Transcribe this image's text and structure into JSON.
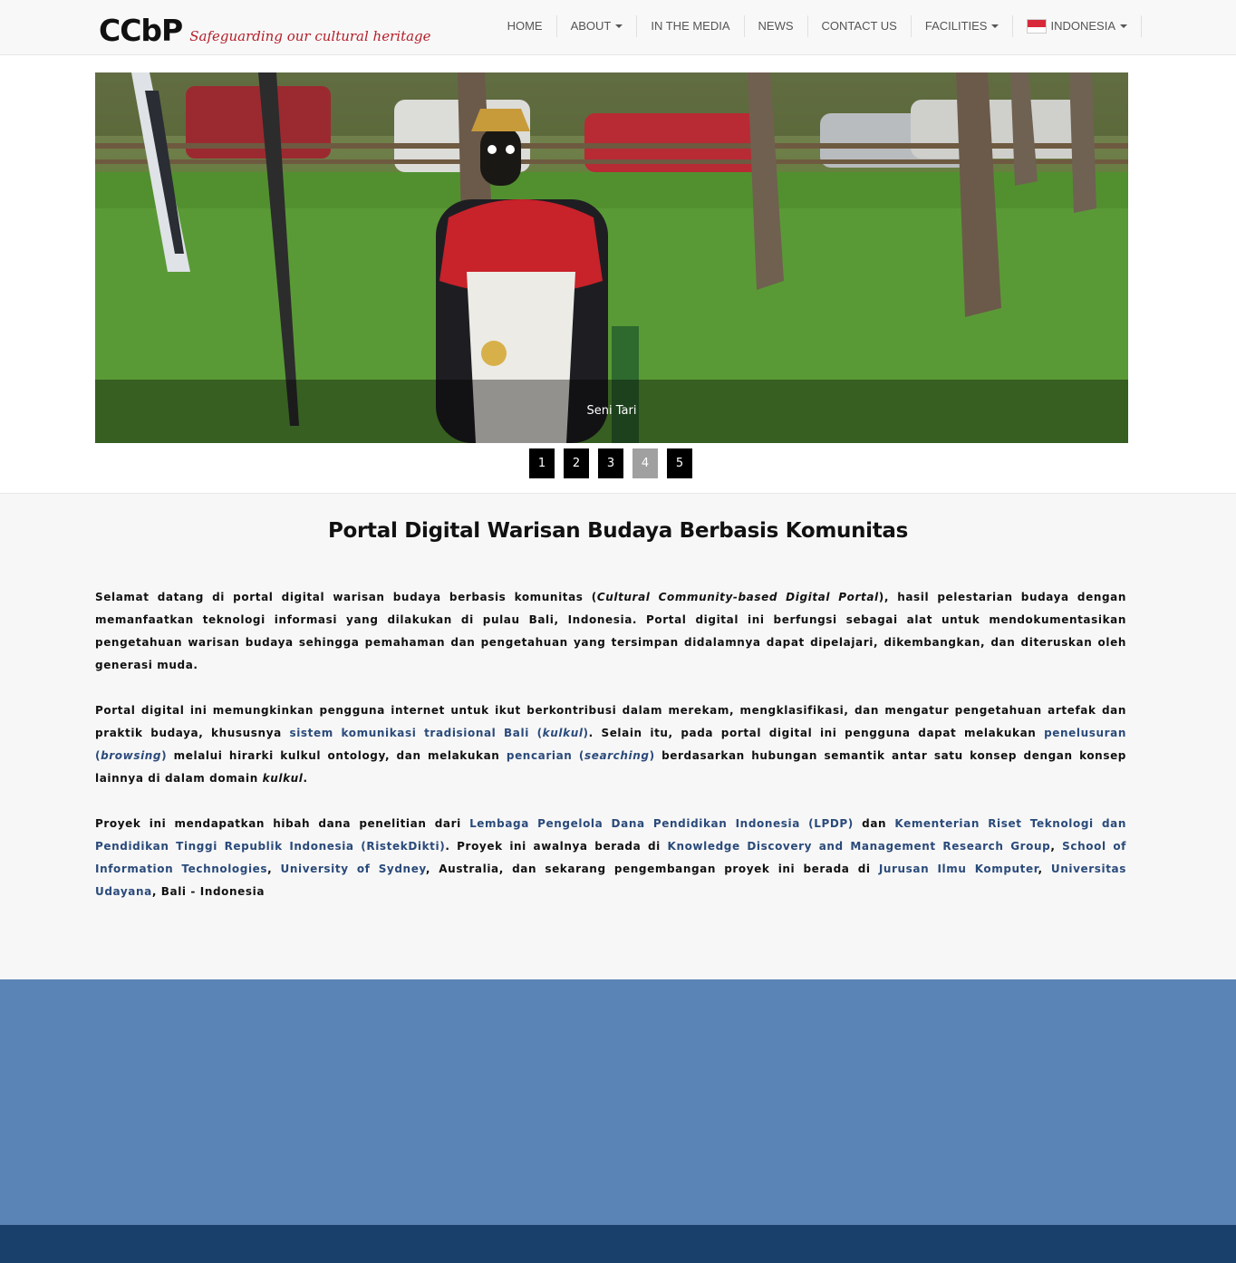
{
  "brand": {
    "name": "CCbP",
    "tagline": "Safeguarding our cultural heritage"
  },
  "nav": {
    "home": "HOME",
    "about": "ABOUT",
    "media": "IN THE MEDIA",
    "news": "NEWS",
    "contact": "CONTACT US",
    "facilities": "FACILITIES",
    "language": "INDONESIA"
  },
  "carousel": {
    "caption": "Seni Tari",
    "pages": [
      "1",
      "2",
      "3",
      "4",
      "5"
    ],
    "active_page": "4"
  },
  "main": {
    "title": "Portal Digital Warisan Budaya Berbasis Komunitas",
    "p1": {
      "a": "Selamat datang di portal digital warisan budaya berbasis komunitas (",
      "em": "Cultural Community-based Digital Portal",
      "b": "), hasil pelestarian budaya dengan memanfaatkan teknologi informasi yang dilakukan di pulau Bali, Indonesia. Portal digital ini berfungsi sebagai alat untuk mendokumentasikan pengetahuan warisan budaya sehingga pemahaman dan pengetahuan yang tersimpan didalamnya dapat dipelajari, dikembangkan, dan diteruskan oleh generasi muda."
    },
    "p2": {
      "a": "Portal digital ini memungkinkan pengguna internet untuk ikut berkontribusi dalam merekam, mengklasifikasi, dan mengatur pengetahuan artefak dan praktik budaya, khususnya ",
      "link1": "sistem komunikasi tradisional Bali (",
      "link1_em": "kulkul",
      "link1_end": ")",
      "b": ". Selain itu, pada portal digital ini pengguna dapat melakukan ",
      "link2": "penelusuran (",
      "link2_em": "browsing",
      "link2_end": ")",
      "c": " melalui hirarki kulkul ontology, dan melakukan ",
      "link3": "pencarian (",
      "link3_em": "searching",
      "link3_end": ")",
      "d": " berdasarkan hubungan semantik antar satu konsep dengan konsep lainnya di dalam domain ",
      "em": "kulkul",
      "e": "."
    },
    "p3": {
      "a": "Proyek ini mendapatkan hibah dana penelitian dari ",
      "link1": "Lembaga Pengelola Dana Pendidikan Indonesia (LPDP)",
      "b": " dan ",
      "link2": "Kementerian Riset Teknologi dan Pendidikan Tinggi Republik Indonesia (RistekDikti)",
      "c": ". Proyek ini awalnya berada di ",
      "link3": "Knowledge Discovery and Management Research Group",
      "d": ", ",
      "link4": "School of Information Technologies",
      "e": ", ",
      "link5": "University of Sydney",
      "f": ", Australia, dan sekarang pengembangan proyek ini berada di ",
      "link6": "Jurusan Ilmu Komputer",
      "g": ", ",
      "link7": "Universitas Udayana",
      "h": ", Bali - Indonesia"
    }
  },
  "colors": {
    "accent_red": "#b3202a",
    "link_blue": "#2a4a7a",
    "footer_top": "#5b84b6",
    "footer_bottom": "#19406b"
  }
}
